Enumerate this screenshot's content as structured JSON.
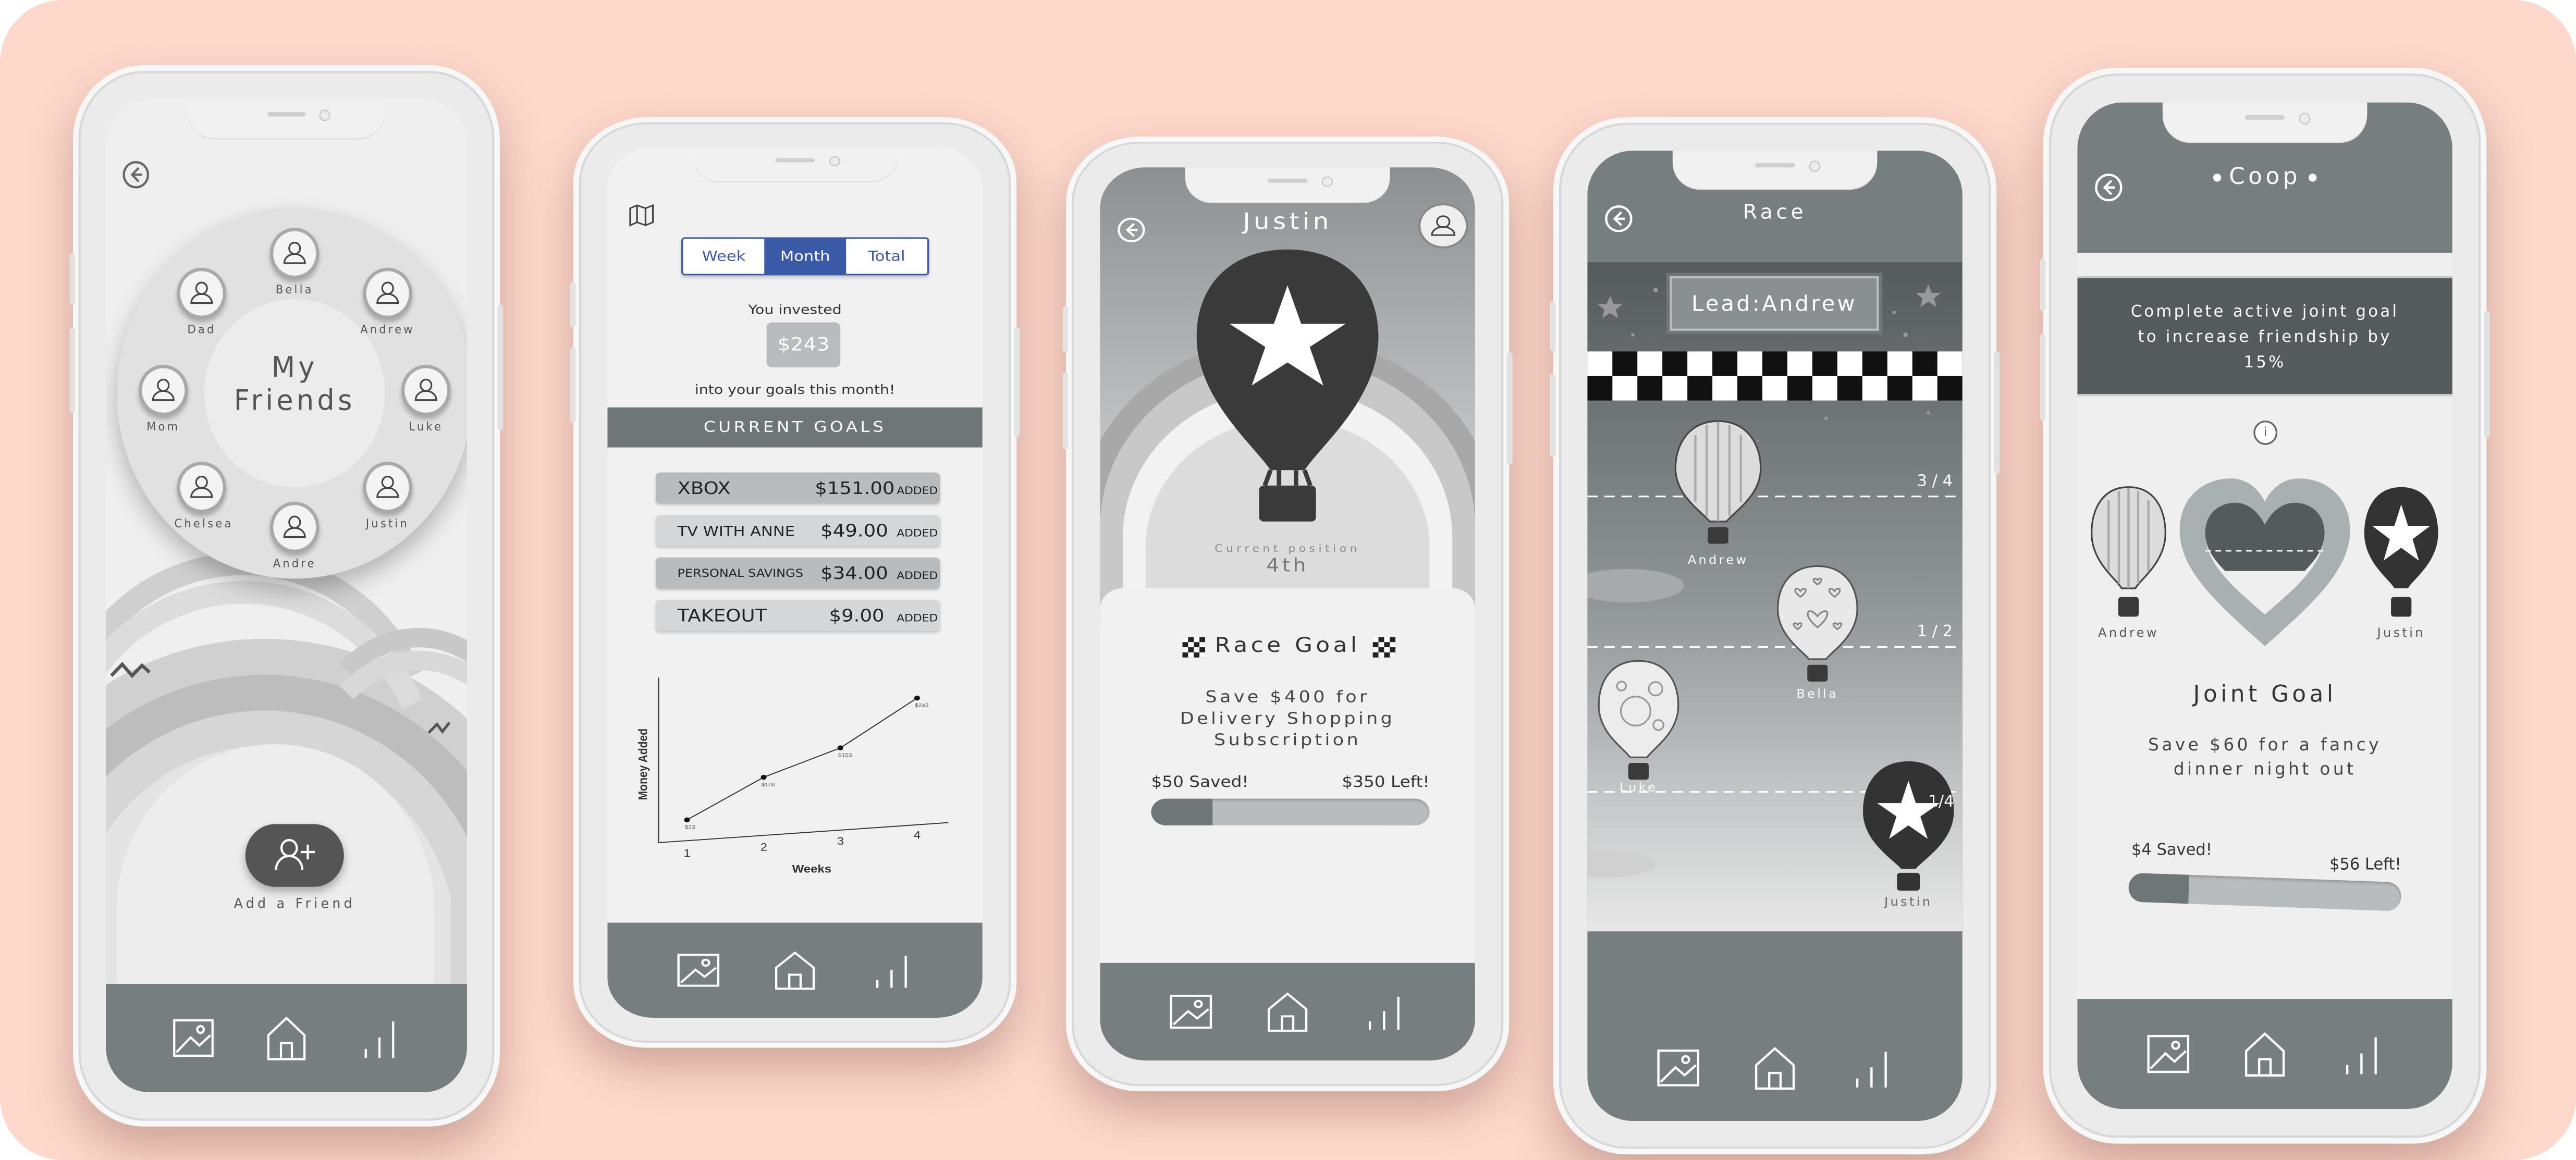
{
  "phone1": {
    "wheel_title": "My\nFriends",
    "friends": [
      "Bella",
      "Andrew",
      "Luke",
      "Justin",
      "Andre",
      "Chelsea",
      "Mom",
      "Dad"
    ],
    "add_friend_label": "Add a Friend"
  },
  "phone2": {
    "period_tabs": [
      "Week",
      "Month",
      "Total"
    ],
    "selected_period": "Month",
    "invested_prefix": "You invested",
    "invested_amount": "$243",
    "invested_suffix": "into your goals this month!",
    "current_goals_title": "CURRENT GOALS",
    "goals": [
      {
        "name": "XBOX",
        "amount": "$151.00",
        "tag": "ADDED"
      },
      {
        "name": "TV WITH ANNE",
        "amount": "$49.00",
        "tag": "ADDED"
      },
      {
        "name": "PERSONAL SAVINGS",
        "amount": "$34.00",
        "tag": "ADDED"
      },
      {
        "name": "TAKEOUT",
        "amount": "$9.00",
        "tag": "ADDED"
      }
    ],
    "chart_data": {
      "type": "line",
      "xlabel": "Weeks",
      "ylabel": "Money Added",
      "categories": [
        "1",
        "2",
        "3",
        "4"
      ],
      "values": [
        23,
        100,
        153,
        243
      ],
      "data_labels": [
        "$23",
        "$100",
        "$153",
        "$243"
      ],
      "ylim": [
        0,
        280
      ]
    }
  },
  "phone3": {
    "name": "Justin",
    "position_label": "Current position",
    "position_value": "4th",
    "goal_title": "Race Goal",
    "goal_description": "Save $400 for Delivery Shopping Subscription",
    "saved_label": "$50 Saved!",
    "left_label": "$350 Left!",
    "progress_fraction": 0.125
  },
  "phone4": {
    "title": "Race",
    "lead_label": "Lead:Andrew",
    "racers": [
      {
        "name": "Andrew",
        "lane_marker": "3 / 4"
      },
      {
        "name": "Bella",
        "lane_marker": "1 / 2"
      },
      {
        "name": "Luke",
        "lane_marker": ""
      },
      {
        "name": "Justin",
        "lane_marker": "1/4"
      }
    ]
  },
  "phone5": {
    "title": "Coop",
    "banner_text": "Complete active joint goal to increase friendship by 15%",
    "left_friend": "Andrew",
    "right_friend": "Justin",
    "goal_title": "Joint Goal",
    "goal_description": "Save $60 for a fancy dinner night out",
    "saved_label": "$4 Saved!",
    "left_label": "$56 Left!",
    "progress_fraction": 0.067
  },
  "tabbar": {
    "icons": [
      "gallery-icon",
      "home-icon",
      "stats-icon"
    ]
  },
  "colors": {
    "background": "#fdd8cb",
    "tabbar": "#777e80",
    "accent_blue": "#3a5aa8",
    "dark_balloon": "#3a3a3a"
  }
}
